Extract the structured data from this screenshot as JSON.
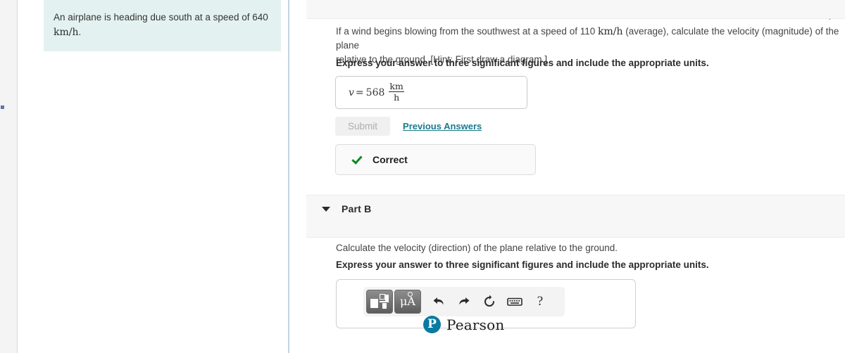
{
  "left_panel": {
    "stem_line1": "An airplane is heading due south at a speed of 640",
    "stem_unit": "km/h",
    "stem_period": "."
  },
  "top_right": {
    "status_icon": "check-icon"
  },
  "part_a": {
    "question_pre": "If a wind begins blowing from the southwest at a speed of 110 ",
    "question_unit": "km/h",
    "question_post": " (average), calculate the velocity (magnitude) of the plane",
    "question_line2": "relative to the ground. [Hint: First draw a diagram.]",
    "instruction": "Express your answer to three significant figures and include the appropriate units.",
    "answer": {
      "variable": "v",
      "equals": "=",
      "value": "568",
      "unit_numerator": "km",
      "unit_denominator": "h"
    },
    "submit_label": "Submit",
    "previous_answers_label": "Previous Answers",
    "feedback_label": "Correct",
    "feedback_icon": "check-icon"
  },
  "part_b": {
    "caret_icon": "caret-down-icon",
    "title": "Part B",
    "question": "Calculate the velocity (direction) of the plane relative to the ground.",
    "instruction": "Express your answer to three significant figures and include the appropriate units.",
    "toolbar": {
      "template_label": "math-template",
      "units_label": "μA",
      "undo_label": "undo-arrow",
      "redo_label": "redo-arrow",
      "reset_label": "reset-circle",
      "keyboard_label": "keyboard",
      "help_label": "?"
    }
  },
  "footer": {
    "brand_letter": "P",
    "brand_name": "Pearson"
  },
  "colors": {
    "accent_teal": "#0a7ba0",
    "link_teal": "#1a7b8c",
    "correct_green": "#15862b",
    "stem_bg": "#e3f2f0",
    "band_bg": "#f7f7f7"
  }
}
